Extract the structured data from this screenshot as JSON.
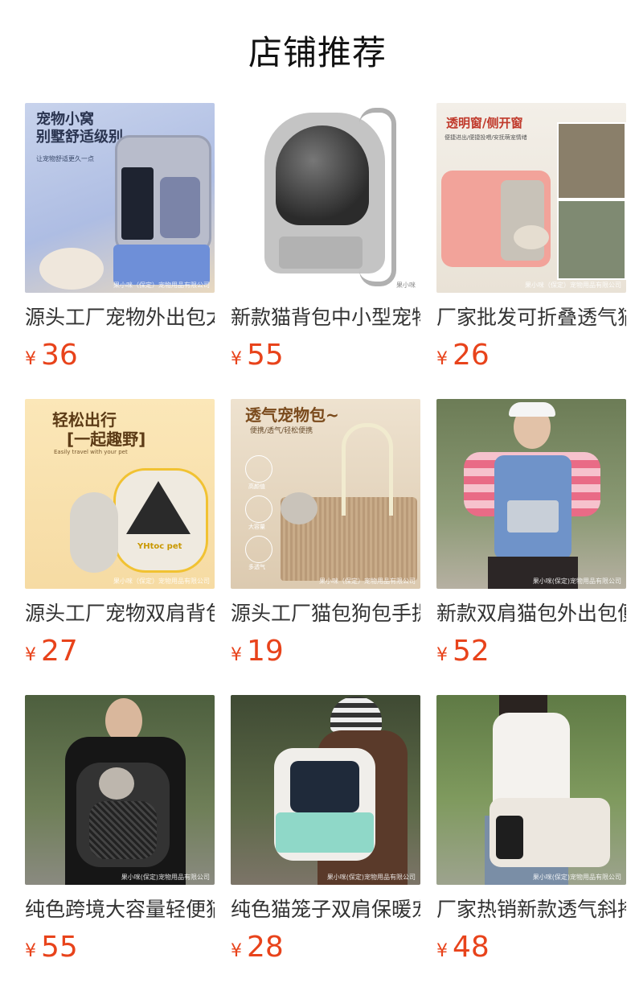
{
  "section": {
    "title": "店铺推荐"
  },
  "currency": "¥",
  "products": [
    {
      "name": "源头工厂宠物外出包太空舱",
      "price": "36",
      "img_text": [
        "宠物小窝",
        "别墅舒适级别",
        "让宠物舒适更久一点"
      ],
      "watermark": "果小咪（保定）宠物用品有限公司",
      "image": "cat-backpack-blue-grey"
    },
    {
      "name": "新款猫背包中小型宠物太空舱",
      "price": "55",
      "img_text": [],
      "watermark": "果小咪",
      "image": "grey-capsule-backpack"
    },
    {
      "name": "厂家批发可折叠透气猫包",
      "price": "26",
      "img_text": [
        "透明窗/侧开窗",
        "便捷进出/便捷投喂/安抚萌宠情绪"
      ],
      "watermark": "果小咪（保定）宠物用品有限公司",
      "image": "pink-foldable-carrier"
    },
    {
      "name": "源头工厂宠物双肩背包",
      "price": "27",
      "img_text": [
        "轻松出行",
        "[一起趣野]",
        "Easily travel with your pet",
        "YHtoc pet"
      ],
      "watermark": "果小咪（保定）宠物用品有限公司",
      "image": "yellow-triangle-backpack"
    },
    {
      "name": "源头工厂猫包狗包手提包",
      "price": "19",
      "img_text": [
        "透气宠物包~",
        "便携/透气/轻松便携",
        "高颜值",
        "大容量",
        "多透气"
      ],
      "watermark": "果小咪（保定）宠物用品有限公司",
      "image": "mesh-tote-bag"
    },
    {
      "name": "新款双肩猫包外出包便携",
      "price": "52",
      "img_text": [],
      "watermark": "果小咪(保定)宠物用品有限公司",
      "image": "woman-blue-backpack"
    },
    {
      "name": "纯色跨境大容量轻便猫包",
      "price": "55",
      "img_text": [],
      "watermark": "果小咪(保定)宠物用品有限公司",
      "image": "woman-front-mesh-carrier"
    },
    {
      "name": "纯色猫笼子双肩保暖宠物包",
      "price": "28",
      "img_text": [],
      "watermark": "果小咪(保定)宠物用品有限公司",
      "image": "mint-capsule-backpack"
    },
    {
      "name": "厂家热销新款透气斜挎猫包",
      "price": "48",
      "img_text": [],
      "watermark": "果小咪(保定)宠物用品有限公司",
      "image": "white-shoulder-carrier"
    }
  ]
}
